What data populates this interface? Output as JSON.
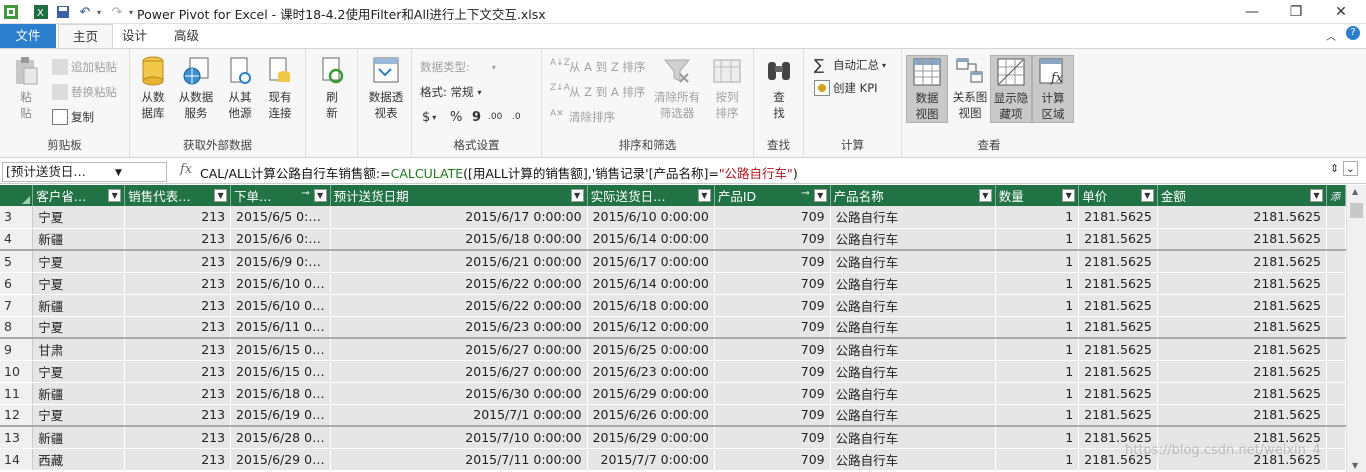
{
  "window": {
    "title": "Power Pivot for Excel - 课时18-4.2使用Filter和All进行上下文交互.xlsx",
    "minimize": "—",
    "restore": "❐",
    "close": "✕"
  },
  "tabs": [
    "文件",
    "主页",
    "设计",
    "高级"
  ],
  "ribbon": {
    "clipboard": {
      "paste": "粘\n贴",
      "append_paste": "追加粘贴",
      "replace_paste": "替换粘贴",
      "copy": "复制",
      "label": "剪贴板"
    },
    "external": {
      "from_db": "从数\n据库",
      "from_service": "从数据\n服务",
      "from_other": "从其\n他源",
      "existing": "现有\n连接",
      "label": "获取外部数据"
    },
    "refresh": "刷\n新",
    "pivot": "数据透\n视表",
    "format": {
      "data_type": "数据类型:",
      "format": "格式: 常规",
      "currency": "$",
      "percent": "%",
      "comma": "9",
      "inc_dec": ".00",
      "dec_dec": ".0",
      "label": "格式设置"
    },
    "sort": {
      "a_z": "从 A 到 Z 排序",
      "z_a": "从 Z 到 A 排序",
      "clear_sort": "清除排序",
      "clear_filters": "清除所有\n筛选器",
      "sort_by_col": "按列\n排序",
      "label": "排序和筛选"
    },
    "find": {
      "find": "查\n找",
      "label": "查找"
    },
    "calc": {
      "autosum": "自动汇总",
      "kpi": "创建 KPI",
      "label": "计算"
    },
    "view": {
      "data_view": "数据\n视图",
      "diagram_view": "关系图\n视图",
      "show_hidden": "显示隐\n藏项",
      "calc_area": "计算\n区域",
      "label": "查看"
    }
  },
  "formula_bar": {
    "name_box": "[预计送货日…",
    "fx": "fx",
    "p1": "CAL/ALL计算公路自行车销售额:=",
    "fn": "CALCULATE",
    "p2": "([用ALL计算的销售额],'销售记录'[产品名称]=",
    "str": "\"公路自行车\"",
    "p3": ")"
  },
  "columns": [
    "客户省…",
    "销售代表…",
    "下单…",
    "预计送货日期",
    "实际送货日…",
    "产品ID",
    "产品名称",
    "数量",
    "单价",
    "金额"
  ],
  "rows": [
    {
      "n": "3",
      "c": [
        "宁夏",
        "213",
        "2015/6/5 0:…",
        "2015/6/17 0:00:00",
        "2015/6/10 0:00:00",
        "709",
        "公路自行车",
        "1",
        "2181.5625",
        "2181.5625"
      ]
    },
    {
      "n": "4",
      "c": [
        "新疆",
        "213",
        "2015/6/6 0:…",
        "2015/6/18 0:00:00",
        "2015/6/14 0:00:00",
        "709",
        "公路自行车",
        "1",
        "2181.5625",
        "2181.5625"
      ]
    },
    {
      "n": "5",
      "c": [
        "宁夏",
        "213",
        "2015/6/9 0:…",
        "2015/6/21 0:00:00",
        "2015/6/17 0:00:00",
        "709",
        "公路自行车",
        "1",
        "2181.5625",
        "2181.5625"
      ],
      "sep": true
    },
    {
      "n": "6",
      "c": [
        "宁夏",
        "213",
        "2015/6/10 0…",
        "2015/6/22 0:00:00",
        "2015/6/14 0:00:00",
        "709",
        "公路自行车",
        "1",
        "2181.5625",
        "2181.5625"
      ]
    },
    {
      "n": "7",
      "c": [
        "新疆",
        "213",
        "2015/6/10 0…",
        "2015/6/22 0:00:00",
        "2015/6/18 0:00:00",
        "709",
        "公路自行车",
        "1",
        "2181.5625",
        "2181.5625"
      ]
    },
    {
      "n": "8",
      "c": [
        "宁夏",
        "213",
        "2015/6/11 0…",
        "2015/6/23 0:00:00",
        "2015/6/12 0:00:00",
        "709",
        "公路自行车",
        "1",
        "2181.5625",
        "2181.5625"
      ]
    },
    {
      "n": "9",
      "c": [
        "甘肃",
        "213",
        "2015/6/15 0…",
        "2015/6/27 0:00:00",
        "2015/6/25 0:00:00",
        "709",
        "公路自行车",
        "1",
        "2181.5625",
        "2181.5625"
      ],
      "sep": true
    },
    {
      "n": "10",
      "c": [
        "宁夏",
        "213",
        "2015/6/15 0…",
        "2015/6/27 0:00:00",
        "2015/6/23 0:00:00",
        "709",
        "公路自行车",
        "1",
        "2181.5625",
        "2181.5625"
      ]
    },
    {
      "n": "11",
      "c": [
        "新疆",
        "213",
        "2015/6/18 0…",
        "2015/6/30 0:00:00",
        "2015/6/29 0:00:00",
        "709",
        "公路自行车",
        "1",
        "2181.5625",
        "2181.5625"
      ]
    },
    {
      "n": "12",
      "c": [
        "宁夏",
        "213",
        "2015/6/19 0…",
        "2015/7/1 0:00:00",
        "2015/6/26 0:00:00",
        "709",
        "公路自行车",
        "1",
        "2181.5625",
        "2181.5625"
      ]
    },
    {
      "n": "13",
      "c": [
        "新疆",
        "213",
        "2015/6/28 0…",
        "2015/7/10 0:00:00",
        "2015/6/29 0:00:00",
        "709",
        "公路自行车",
        "1",
        "2181.5625",
        "2181.5625"
      ],
      "sep": true
    },
    {
      "n": "14",
      "c": [
        "西藏",
        "213",
        "2015/6/29 0…",
        "2015/7/11 0:00:00",
        "2015/7/7 0:00:00",
        "709",
        "公路自行车",
        "1",
        "2181.5625",
        "2181.5625"
      ]
    }
  ],
  "watermark": "https://blog.csdn.net/weixin_4"
}
